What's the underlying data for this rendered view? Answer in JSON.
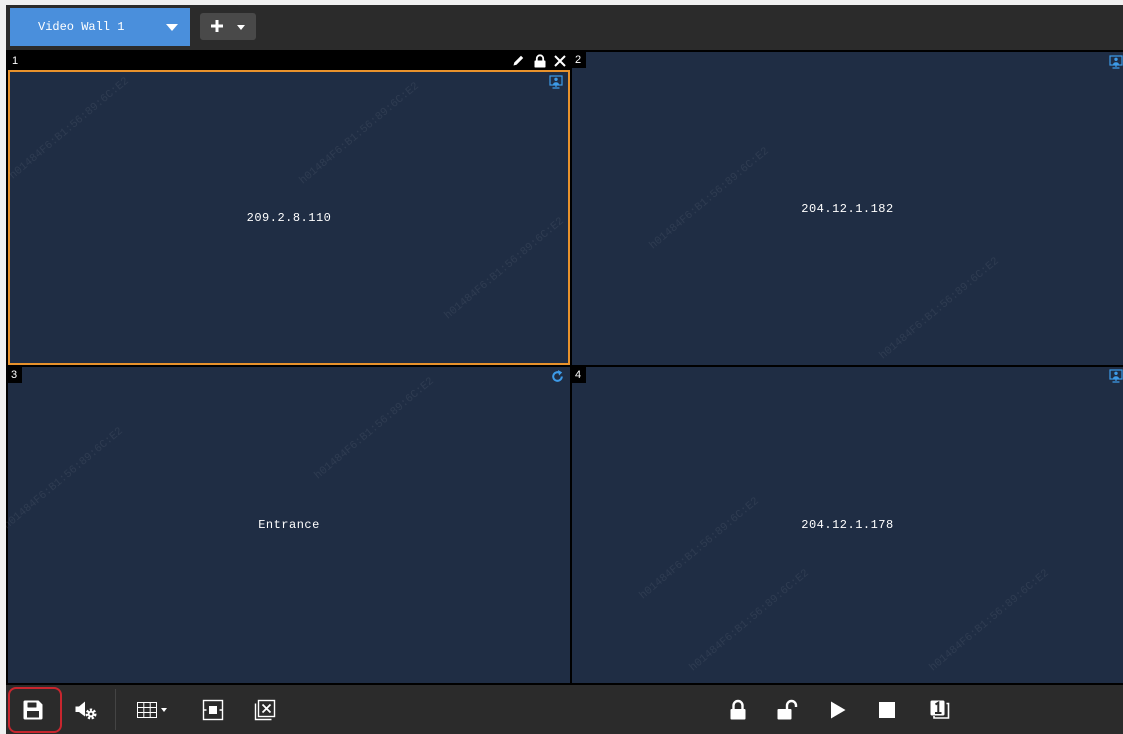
{
  "tab_bar": {
    "tabs": [
      {
        "label": "Video Wall 1",
        "active": true
      }
    ],
    "add_button_icon": "plus-icon"
  },
  "windows": [
    {
      "number": "1",
      "label": "209.2.8.110",
      "selected": true,
      "status_icon": "monitor-icon",
      "header_icons": [
        "edit-icon",
        "lock-icon",
        "close-icon"
      ]
    },
    {
      "number": "2",
      "label": "204.12.1.182",
      "selected": false,
      "status_icon": "monitor-icon"
    },
    {
      "number": "3",
      "label": "Entrance",
      "selected": false,
      "status_icon": "refresh-icon"
    },
    {
      "number": "4",
      "label": "204.12.1.178",
      "selected": false,
      "status_icon": "monitor-icon"
    }
  ],
  "toolbar": {
    "left": [
      {
        "icon": "save-icon",
        "highlighted": true
      },
      {
        "icon": "audio-settings-icon"
      },
      {
        "icon": "window-division-icon",
        "has_dropdown": true
      },
      {
        "icon": "window-fit-icon"
      },
      {
        "icon": "clear-windows-icon"
      }
    ],
    "right": [
      {
        "icon": "lock-icon"
      },
      {
        "icon": "unlock-icon"
      },
      {
        "icon": "play-icon"
      },
      {
        "icon": "stop-icon"
      },
      {
        "icon": "window-number-icon"
      }
    ]
  },
  "watermark": "h01484F6:B1:56:89:6C:E2",
  "colors": {
    "tab_active": "#4a8fdc",
    "pane_background": "#1f2d44",
    "selected_border": "#e8922c",
    "status_icon": "#3d9be9",
    "highlight": "#c8262e",
    "bar_background": "#2b2b2b"
  }
}
